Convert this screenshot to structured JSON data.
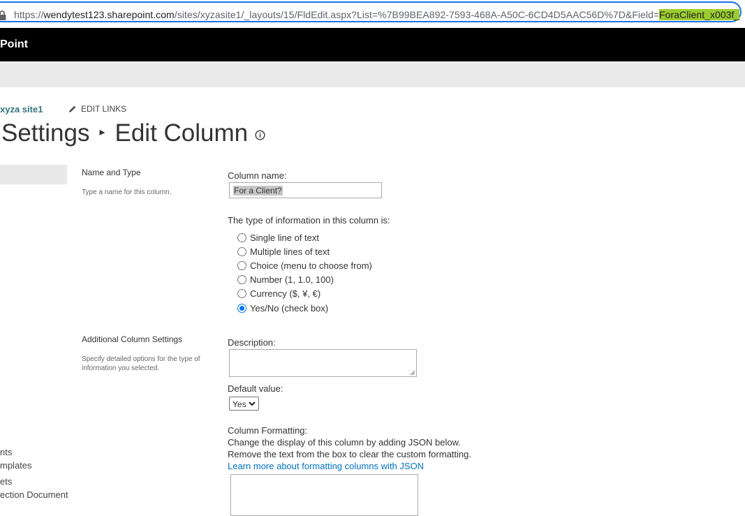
{
  "browser": {
    "url_prefix": "https://",
    "url_host": "wendytest123.sharepoint.com",
    "url_path": "/sites/xyzasite1/_layouts/15/FldEdit.aspx?List=%7B99BEA892-7593-468A-A50C-6CD4D5AAC56D%7D&Field=",
    "url_selected": "ForaClient_x003f_"
  },
  "suite_bar": {
    "title": "Point"
  },
  "breadcrumb": {
    "site_link": "xyza site1",
    "edit_links": "EDIT LINKS"
  },
  "page": {
    "title_parent": "Settings",
    "title_separator": "▸",
    "title_current": "Edit Column"
  },
  "left_nav": {
    "items": [
      "nts",
      "mplates",
      "ets",
      "ection Document"
    ]
  },
  "name_type_section": {
    "title": "Name and Type",
    "description": "Type a name for this column.",
    "column_name_label": "Column name:",
    "column_name_value": "For a Client?",
    "type_label": "The type of information in this column is:",
    "types": [
      {
        "label": "Single line of text",
        "checked": false
      },
      {
        "label": "Multiple lines of text",
        "checked": false
      },
      {
        "label": "Choice (menu to choose from)",
        "checked": false
      },
      {
        "label": "Number (1, 1.0, 100)",
        "checked": false
      },
      {
        "label": "Currency ($, ¥, €)",
        "checked": false
      },
      {
        "label": "Yes/No (check box)",
        "checked": true
      }
    ]
  },
  "additional_section": {
    "title": "Additional Column Settings",
    "description": "Specify detailed options for the type of information you selected.",
    "description_label": "Description:",
    "description_value": "",
    "default_value_label": "Default value:",
    "default_value_selected": "Yes",
    "formatting_label": "Column Formatting:",
    "formatting_help_1": "Change the display of this column by adding JSON below.",
    "formatting_help_2": "Remove the text from the box to clear the custom formatting.",
    "formatting_link": "Learn more about formatting columns with JSON",
    "formatting_value": ""
  },
  "colors": {
    "suite_bar": "#000000",
    "site_link": "#31757a",
    "link": "#0072c6",
    "url_selection": "#9ccc2e",
    "address_focus": "#1a73e8"
  }
}
